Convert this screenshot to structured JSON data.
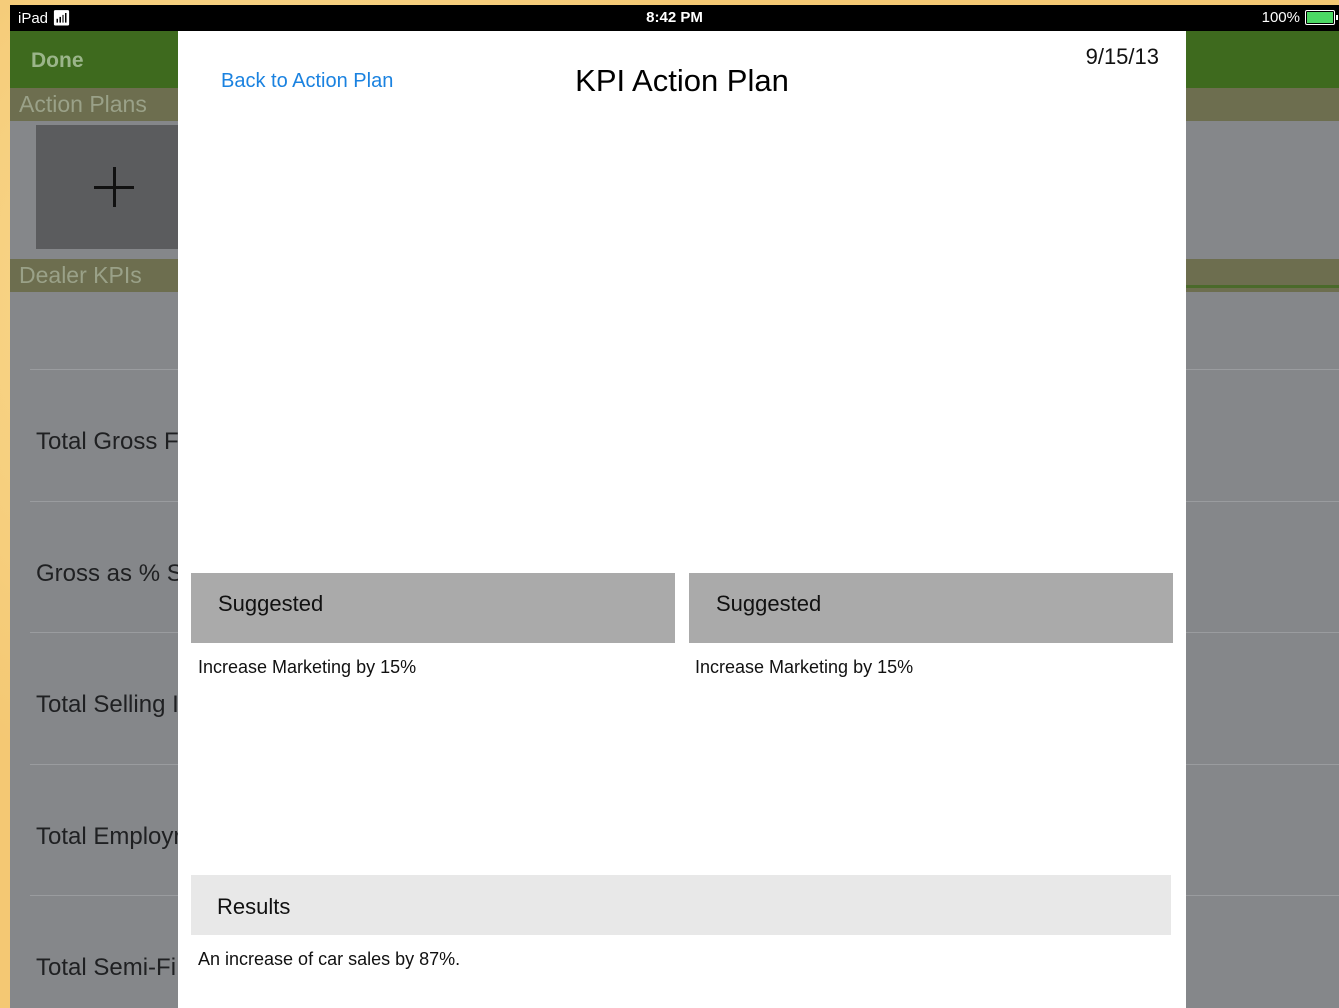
{
  "status_bar": {
    "device": "iPad",
    "time": "8:42 PM",
    "battery": "100%"
  },
  "background": {
    "done_label": "Done",
    "action_plans_header": "Action Plans",
    "dealer_kpis_header": "Dealer KPIs",
    "kpi_rows": [
      "Total Gross F",
      "Gross as % S",
      "Total Selling I",
      "Total Employr",
      "Total Semi-Fi"
    ]
  },
  "modal": {
    "back_label": "Back to Action Plan",
    "title": "KPI Action Plan",
    "date": "9/15/13",
    "suggested_left": {
      "header": "Suggested",
      "text": "Increase Marketing by 15%"
    },
    "suggested_right": {
      "header": "Suggested",
      "text": "Increase Marketing by 15%"
    },
    "results": {
      "header": "Results",
      "text": "An increase of car sales by 87%."
    }
  },
  "colors": {
    "nav_green": "#3e6a1e",
    "link_blue": "#1a82e0",
    "panel_gray": "#aaaaaa",
    "results_gray": "#e8e8e8"
  }
}
